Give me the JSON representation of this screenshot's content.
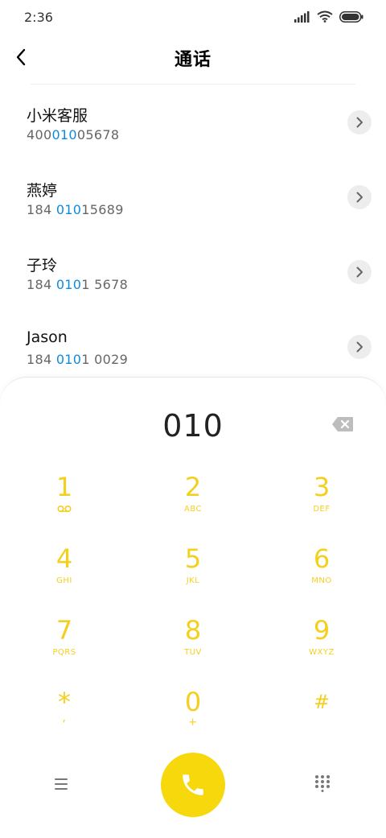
{
  "status": {
    "time": "2:36"
  },
  "header": {
    "title": "通话"
  },
  "results": [
    {
      "name": "小米客服",
      "num_pre": "400",
      "num_hl": "010",
      "num_post": "05678"
    },
    {
      "name": "燕婷",
      "num_pre": "184 ",
      "num_hl": "010",
      "num_post": "15689"
    },
    {
      "name": "子玲",
      "num_pre": "184 ",
      "num_hl": "010",
      "num_post": "1 5678"
    },
    {
      "name": "Jason",
      "num_pre": "184 ",
      "num_hl": "010",
      "num_post": "1 0029"
    }
  ],
  "dialer": {
    "entry": "010",
    "keys": [
      {
        "digit": "1",
        "letters": "voicemail"
      },
      {
        "digit": "2",
        "letters": "ABC"
      },
      {
        "digit": "3",
        "letters": "DEF"
      },
      {
        "digit": "4",
        "letters": "GHI"
      },
      {
        "digit": "5",
        "letters": "JKL"
      },
      {
        "digit": "6",
        "letters": "MNO"
      },
      {
        "digit": "7",
        "letters": "PQRS"
      },
      {
        "digit": "8",
        "letters": "TUV"
      },
      {
        "digit": "9",
        "letters": "WXYZ"
      },
      {
        "digit": "*",
        "letters": ","
      },
      {
        "digit": "0",
        "letters": "+"
      },
      {
        "digit": "#",
        "letters": ""
      }
    ]
  },
  "colors": {
    "accent": "#f6d80d",
    "digit": "#f5cf1e",
    "match": "#0a8ce0"
  },
  "icons": [
    "signal-icon",
    "wifi-icon",
    "battery-icon",
    "back-arrow-icon",
    "chevron-right-icon",
    "backspace-icon",
    "voicemail-icon",
    "menu-icon",
    "phone-icon",
    "dialpad-icon"
  ]
}
